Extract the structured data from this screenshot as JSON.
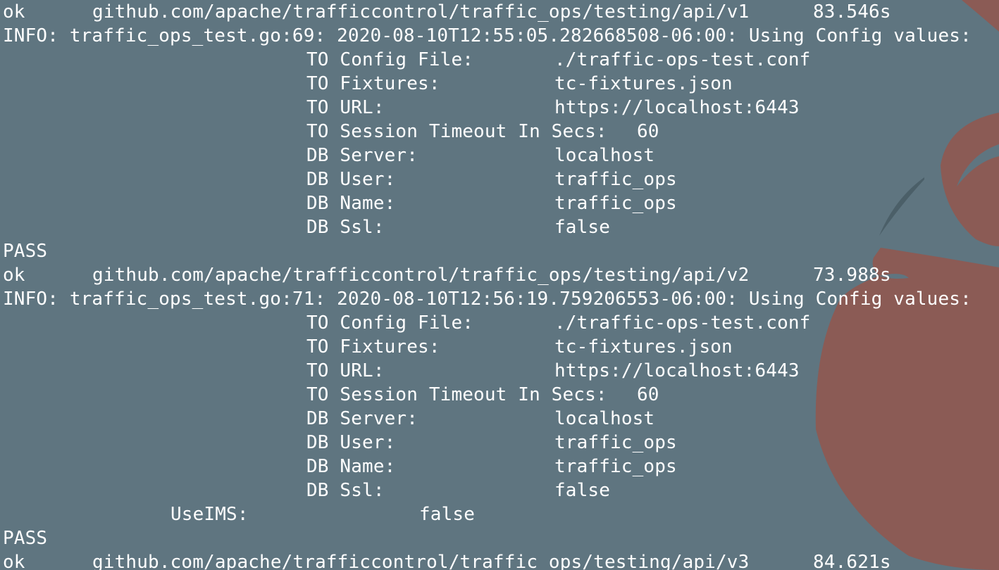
{
  "terminal": {
    "background_color": "#5f7580",
    "text_color": "#ffffff",
    "wallpaper_accent_color": "#8b5b55",
    "blocks": [
      {
        "ok_line": {
          "status": "ok",
          "package": "github.com/apache/trafficcontrol/traffic_ops/testing/api/v1",
          "duration": "83.546s"
        },
        "info_line": "INFO: traffic_ops_test.go:69: 2020-08-10T12:55:05.282668508-06:00: Using Config values:",
        "config": [
          {
            "key": "TO Config File:",
            "value": "./traffic-ops-test.conf"
          },
          {
            "key": "TO Fixtures:",
            "value": "tc-fixtures.json"
          },
          {
            "key": "TO URL:",
            "value": "https://localhost:6443"
          },
          {
            "key": "TO Session Timeout In Secs:",
            "value": "60"
          },
          {
            "key": "DB Server:",
            "value": "localhost"
          },
          {
            "key": "DB User:",
            "value": "traffic_ops"
          },
          {
            "key": "DB Name:",
            "value": "traffic_ops"
          },
          {
            "key": "DB Ssl:",
            "value": "false"
          }
        ],
        "pass": "PASS"
      },
      {
        "ok_line": {
          "status": "ok",
          "package": "github.com/apache/trafficcontrol/traffic_ops/testing/api/v2",
          "duration": "73.988s"
        },
        "info_line": "INFO: traffic_ops_test.go:71: 2020-08-10T12:56:19.759206553-06:00: Using Config values:",
        "config": [
          {
            "key": "TO Config File:",
            "value": "./traffic-ops-test.conf"
          },
          {
            "key": "TO Fixtures:",
            "value": "tc-fixtures.json"
          },
          {
            "key": "TO URL:",
            "value": "https://localhost:6443"
          },
          {
            "key": "TO Session Timeout In Secs:",
            "value": "60"
          },
          {
            "key": "DB Server:",
            "value": "localhost"
          },
          {
            "key": "DB User:",
            "value": "traffic_ops"
          },
          {
            "key": "DB Name:",
            "value": "traffic_ops"
          },
          {
            "key": "DB Ssl:",
            "value": "false"
          }
        ],
        "extra": {
          "key": "UseIMS:",
          "value": "false"
        },
        "pass": "PASS"
      }
    ],
    "final_ok_line": {
      "status": "ok",
      "package": "github.com/apache/trafficcontrol/traffic_ops/testing/api/v3",
      "duration": "84.621s"
    }
  }
}
